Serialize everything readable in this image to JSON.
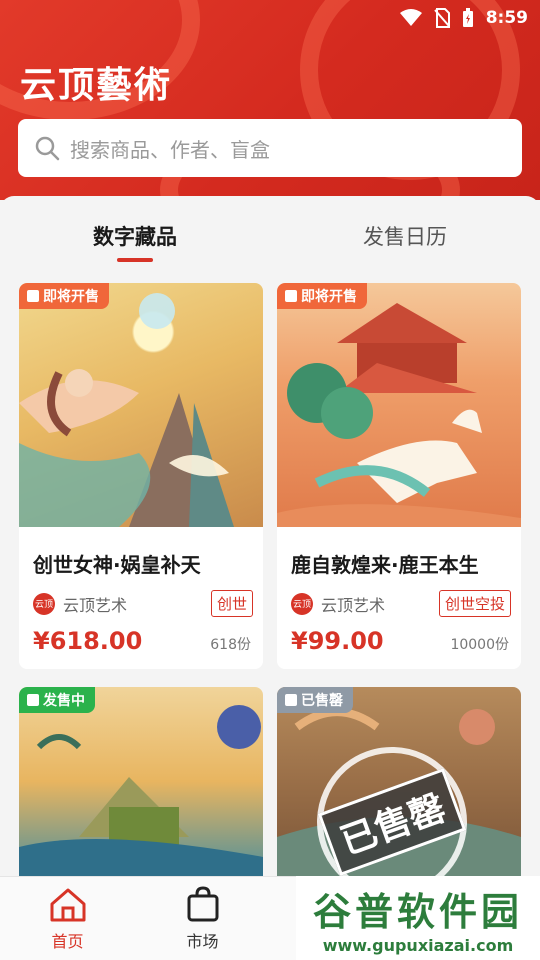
{
  "status_bar": {
    "time": "8:59"
  },
  "brand": "云顶藝術",
  "search": {
    "placeholder": "搜索商品、作者、盲盒"
  },
  "tabs": [
    {
      "label": "数字藏品",
      "active": true
    },
    {
      "label": "发售日历",
      "active": false
    }
  ],
  "cards": [
    {
      "badge": "即将开售",
      "badge_color": "#f0673a",
      "title": "创世女神·娲皇补天",
      "author": "云顶艺术",
      "avatar_text": "云顶",
      "tag": "创世",
      "price": "¥618.00",
      "qty": "618份"
    },
    {
      "badge": "即将开售",
      "badge_color": "#f0673a",
      "title": "鹿自敦煌来·鹿王本生",
      "author": "云顶艺术",
      "avatar_text": "云顶",
      "tag": "创世空投",
      "price": "¥99.00",
      "qty": "10000份"
    },
    {
      "badge": "发售中",
      "badge_color": "#2bb24c"
    },
    {
      "badge": "已售罄",
      "badge_color": "#8f9aa6",
      "stamp": "已售罄"
    }
  ],
  "navbar": [
    {
      "label": "首页",
      "icon": "home-icon",
      "active": true
    },
    {
      "label": "市场",
      "icon": "shopping-bag-icon",
      "active": false
    }
  ],
  "watermark": {
    "text": "谷普软件园",
    "url": "www.gupuxiazai.com"
  },
  "colors": {
    "accent": "#d73427",
    "header": "#e23a2a"
  }
}
